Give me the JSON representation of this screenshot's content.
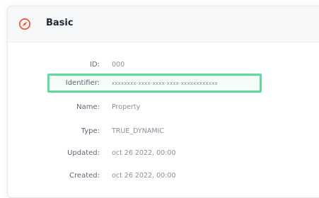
{
  "section": {
    "title": "Basic",
    "icon": "compass-icon",
    "accent_color": "#f05a3a",
    "highlight_color": "#5ddb9b"
  },
  "fields": [
    {
      "label": "ID:",
      "value": "000"
    },
    {
      "label": "Identifier:",
      "value": "xxxxxxxx-xxxx-xxxx-xxxx-xxxxxxxxxxxx"
    },
    {
      "label": "Name:",
      "value": "Property"
    },
    {
      "label": "Type:",
      "value": "TRUE_DYNAMIC"
    },
    {
      "label": "Updated:",
      "value": "oct 26 2022, 00:00"
    },
    {
      "label": "Created:",
      "value": "oct 26 2022, 00:00"
    }
  ]
}
